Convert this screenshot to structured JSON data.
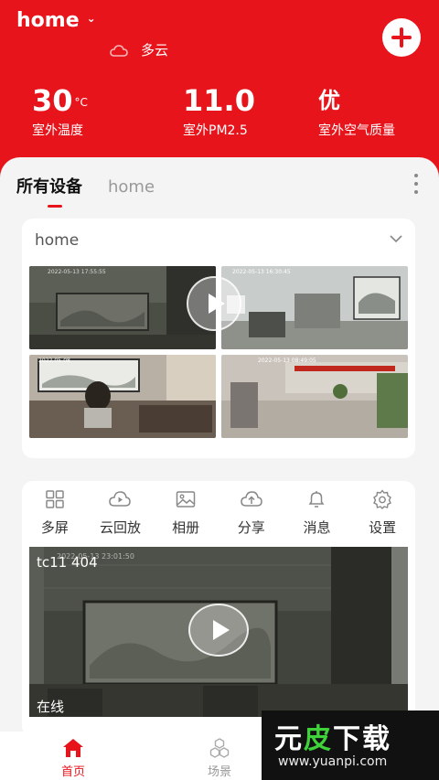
{
  "header": {
    "home_title": "home",
    "weather_text": "多云",
    "temperature": {
      "value": "30",
      "unit": "°C",
      "label": "室外温度"
    },
    "pm25": {
      "value": "11.0",
      "label": "室外PM2.5"
    },
    "air_quality": {
      "value": "优",
      "label": "室外空气质量"
    },
    "colors": {
      "brand": "#e8141c"
    }
  },
  "tabs": [
    {
      "label": "所有设备",
      "active": true
    },
    {
      "label": "home",
      "active": false
    }
  ],
  "home_card": {
    "title": "home",
    "cam1_timestamp": "2022-05-13 17:55:55",
    "cam2_timestamp": "2022-05-13 16:30:45",
    "cam3_timestamp": "2022-05-08",
    "cam4_timestamp": "2022-05-13 08:49:05"
  },
  "actions": [
    {
      "label": "多屏",
      "icon": "grid-icon"
    },
    {
      "label": "云回放",
      "icon": "cloud-play-icon"
    },
    {
      "label": "相册",
      "icon": "album-icon"
    },
    {
      "label": "分享",
      "icon": "cloud-share-icon"
    },
    {
      "label": "消息",
      "icon": "bell-icon"
    },
    {
      "label": "设置",
      "icon": "gear-icon"
    }
  ],
  "device": {
    "name": "tc11 404",
    "timestamp": "2022-05-13 23:01:50",
    "status": "在线"
  },
  "bottom_nav": [
    {
      "label": "首页",
      "icon": "home-icon",
      "active": true
    },
    {
      "label": "场景",
      "icon": "scene-icon",
      "active": false
    }
  ],
  "watermark": {
    "brand_part1": "元",
    "brand_part2": "皮",
    "brand_part3": "下载",
    "url": "www.yuanpi.com"
  }
}
